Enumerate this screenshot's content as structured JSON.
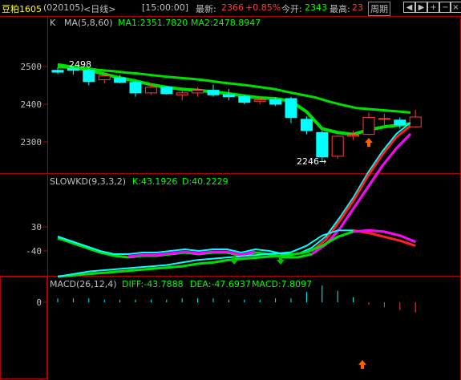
{
  "header": {
    "title": "豆粕1605",
    "code": "(020105)",
    "period": "<日线>",
    "time": "[15:00:00]",
    "latest_label": "最新:",
    "latest_value": "2366",
    "change": "+0.85%",
    "open_label": "今开:",
    "open_value": "2343",
    "high_label": "最高:",
    "high_value": "23",
    "cycle_label": "周期",
    "buttons": [
      "prev",
      "next",
      "zoom-in",
      "zoom-out",
      "close"
    ]
  },
  "main_panel": {
    "k_label": "K",
    "ma_label": "MA(5,8,60)",
    "ma1_label": "MA1:2351.7820",
    "ma2_label": "MA2:2478.8947",
    "high_mark": "2498",
    "low_mark": "2246→",
    "y_ticks": [
      "2500",
      "2400",
      "2300"
    ]
  },
  "kd_panel": {
    "label": "SLOWKD(9,3,3,2)",
    "k_label": "K:43.1926",
    "d_label": "D:40.2229",
    "y_ticks": [
      "30"
    ]
  },
  "macd_panel": {
    "label": "MACD(26,12,4)",
    "diff_label": "DIFF:-43.7888",
    "dea_label": "DEA:-47.6937",
    "macd_label": "MACD:7.8097",
    "y_ticks": [
      "0",
      "-40"
    ]
  },
  "colors": {
    "up": "#ff3c3c",
    "down": "#00ffff",
    "ma1": "#00e000",
    "ma2": "#00e000",
    "k_line": "#ff2020",
    "d_line": "#ff00ff",
    "grid": "#b00000",
    "text_green": "#00ff00",
    "text_yellow": "#ffff00"
  },
  "chart_data": {
    "type": "candlestick",
    "candles": [
      {
        "o": 2490,
        "h": 2498,
        "l": 2480,
        "c": 2485
      },
      {
        "o": 2495,
        "h": 2498,
        "l": 2478,
        "c": 2490
      },
      {
        "o": 2490,
        "h": 2495,
        "l": 2450,
        "c": 2460
      },
      {
        "o": 2465,
        "h": 2480,
        "l": 2455,
        "c": 2475
      },
      {
        "o": 2470,
        "h": 2478,
        "l": 2455,
        "c": 2458
      },
      {
        "o": 2458,
        "h": 2462,
        "l": 2420,
        "c": 2430
      },
      {
        "o": 2430,
        "h": 2455,
        "l": 2425,
        "c": 2445
      },
      {
        "o": 2445,
        "h": 2448,
        "l": 2425,
        "c": 2428
      },
      {
        "o": 2425,
        "h": 2438,
        "l": 2410,
        "c": 2430
      },
      {
        "o": 2430,
        "h": 2445,
        "l": 2420,
        "c": 2437
      },
      {
        "o": 2437,
        "h": 2452,
        "l": 2420,
        "c": 2425
      },
      {
        "o": 2425,
        "h": 2440,
        "l": 2410,
        "c": 2420
      },
      {
        "o": 2420,
        "h": 2425,
        "l": 2400,
        "c": 2405
      },
      {
        "o": 2408,
        "h": 2420,
        "l": 2400,
        "c": 2412
      },
      {
        "o": 2412,
        "h": 2418,
        "l": 2395,
        "c": 2400
      },
      {
        "o": 2415,
        "h": 2420,
        "l": 2350,
        "c": 2365
      },
      {
        "o": 2360,
        "h": 2368,
        "l": 2320,
        "c": 2330
      },
      {
        "o": 2325,
        "h": 2330,
        "l": 2246,
        "c": 2260
      },
      {
        "o": 2262,
        "h": 2318,
        "l": 2255,
        "c": 2315
      },
      {
        "o": 2315,
        "h": 2330,
        "l": 2305,
        "c": 2318
      },
      {
        "o": 2320,
        "h": 2378,
        "l": 2318,
        "c": 2365
      },
      {
        "o": 2360,
        "h": 2375,
        "l": 2340,
        "c": 2362
      },
      {
        "o": 2358,
        "h": 2365,
        "l": 2335,
        "c": 2345
      },
      {
        "o": 2340,
        "h": 2385,
        "l": 2338,
        "c": 2366
      }
    ],
    "ma1": [
      2500,
      2498,
      2490,
      2480,
      2470,
      2462,
      2452,
      2445,
      2440,
      2437,
      2433,
      2428,
      2422,
      2417,
      2415,
      2408,
      2380,
      2335,
      2325,
      2320,
      2332,
      2340,
      2345,
      2350
    ],
    "ma2": [
      2506,
      2500,
      2496,
      2491,
      2488,
      2484,
      2481,
      2477,
      2473,
      2470,
      2467,
      2463,
      2458,
      2454,
      2450,
      2445,
      2440,
      2432,
      2425,
      2418,
      2407,
      2398,
      2390,
      2387,
      2384,
      2381,
      2378
    ],
    "slowkd_k": [
      22,
      19,
      16,
      13,
      11,
      11,
      12,
      12,
      13,
      14,
      13,
      14,
      14,
      12,
      14,
      13,
      11,
      11,
      15,
      22,
      34,
      47,
      62,
      75,
      86,
      93
    ],
    "slowkd_d": [
      23,
      20,
      17,
      14,
      12,
      11,
      12,
      12,
      13,
      14,
      13,
      14,
      14,
      12,
      14,
      13,
      11,
      11,
      13,
      19,
      29,
      42,
      55,
      68,
      79,
      88
    ],
    "macd_diff": [
      -20,
      -22,
      -24,
      -25,
      -26,
      -27,
      -28,
      -29,
      -31,
      -33,
      -34,
      -35,
      -36,
      -37,
      -38,
      -39,
      -44,
      -52,
      -56,
      -56,
      -54,
      -51,
      -48,
      -44
    ],
    "macd_dea": [
      -20,
      -21,
      -22,
      -23,
      -24,
      -25,
      -26,
      -27,
      -28,
      -30,
      -31,
      -33,
      -34,
      -35,
      -36,
      -37,
      -39,
      -44,
      -51,
      -55,
      -56,
      -55,
      -52,
      -47
    ],
    "macd_bars": [
      -3,
      -3,
      -3,
      -2,
      -2,
      -2,
      -2,
      -2,
      -3,
      -3,
      -3,
      -2,
      -2,
      -2,
      -3,
      -3,
      -8,
      -13,
      -9,
      -4,
      2,
      4,
      6,
      8
    ]
  }
}
